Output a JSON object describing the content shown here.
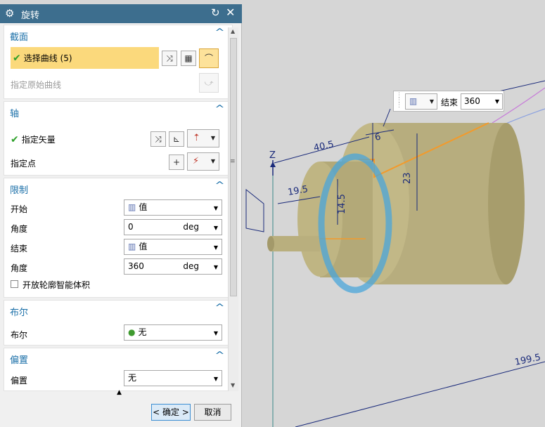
{
  "dialog": {
    "title": "旋转",
    "sections": {
      "section": {
        "header": "截面",
        "select_curve": "选择曲线 (5)",
        "specify_original_curve": "指定原始曲线"
      },
      "axis": {
        "header": "轴",
        "specify_vector": "指定矢量",
        "specify_point": "指定点"
      },
      "limits": {
        "header": "限制",
        "start_label": "开始",
        "start_value": "值",
        "start_angle_label": "角度",
        "start_angle_value": "0",
        "start_angle_unit": "deg",
        "end_label": "结束",
        "end_value": "值",
        "end_angle_label": "角度",
        "end_angle_value": "360",
        "end_angle_unit": "deg",
        "open_profile_label": "开放轮廓智能体积"
      },
      "boolean": {
        "header": "布尔",
        "boolean_label": "布尔",
        "boolean_value": "无"
      },
      "offset": {
        "header": "偏置",
        "offset_label": "偏置",
        "offset_value": "无"
      }
    },
    "ok_label": "< 确定 >",
    "cancel_label": "取消"
  },
  "float_toolbar": {
    "end_label": "结束",
    "end_value": "360"
  },
  "viewport": {
    "axis_label": "Z",
    "dims": [
      "40.5",
      "6",
      "19.5",
      "23",
      "14.5",
      "199.5"
    ]
  },
  "colors": {
    "title_bar": "#3d6e8e",
    "section_header": "#1a6fa8",
    "selected_row": "#fbd97c",
    "viewport_bg": "#d6d6d6"
  }
}
